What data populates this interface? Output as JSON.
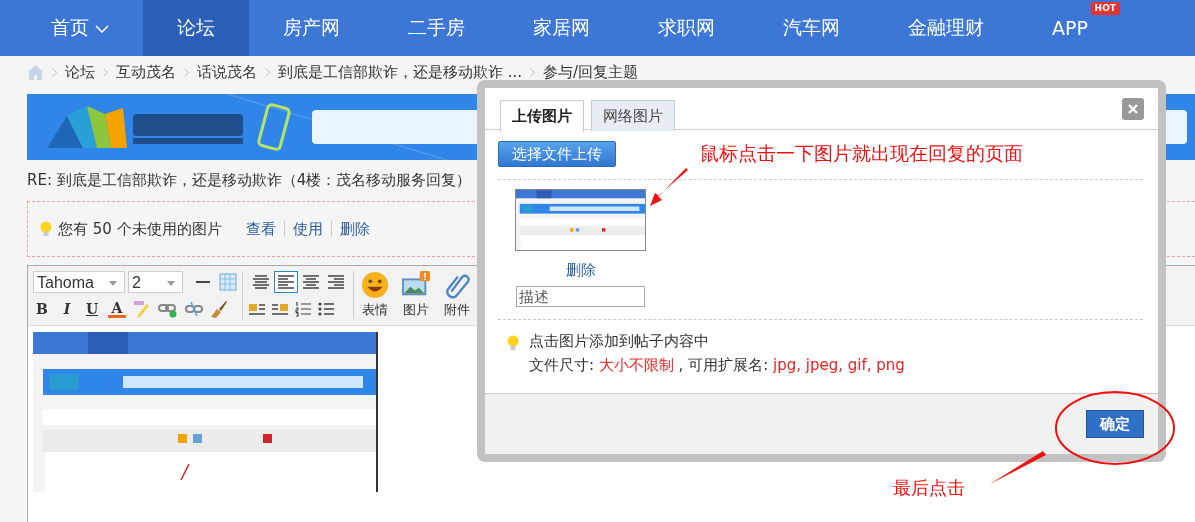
{
  "nav": {
    "items": [
      {
        "label": "首页",
        "selected": false,
        "dropdown": true
      },
      {
        "label": "论坛",
        "selected": true
      },
      {
        "label": "房产网",
        "selected": false
      },
      {
        "label": "二手房",
        "selected": false
      },
      {
        "label": "家居网",
        "selected": false
      },
      {
        "label": "求职网",
        "selected": false
      },
      {
        "label": "汽车网",
        "selected": false
      },
      {
        "label": "金融理财",
        "selected": false
      },
      {
        "label": "APP",
        "selected": false,
        "badge": "HOT"
      }
    ]
  },
  "breadcrumb": [
    "论坛",
    "互动茂名",
    "话说茂名",
    "到底是工信部欺诈，还是移动欺诈 ...",
    "参与/回复主题"
  ],
  "banner": {
    "kind": "picture"
  },
  "post_title": "RE: 到底是工信部欺诈，还是移动欺诈（4楼：茂名移动服务回复）",
  "notice": {
    "text": "您有 50 个未使用的图片",
    "links": [
      "查看",
      "使用",
      "删除"
    ]
  },
  "editor": {
    "font": "Tahoma",
    "size": "2",
    "format_buttons": [
      "B",
      "I",
      "U",
      "A"
    ],
    "align": [
      {
        "selected": false
      },
      {
        "selected": true
      },
      {
        "selected": false
      },
      {
        "selected": false
      }
    ],
    "tools": [
      {
        "label": "表情",
        "kind": "emoji",
        "badge": false
      },
      {
        "label": "图片",
        "badge": true
      },
      {
        "label": "附件",
        "kind": "attach",
        "badge": false
      }
    ],
    "content": {
      "kind": "picture"
    }
  },
  "dialog": {
    "tabs": [
      {
        "label": "上传图片",
        "selected": true
      },
      {
        "label": "网络图片",
        "selected": false
      }
    ],
    "upload_button": "选择文件上传",
    "images": [
      {
        "action": "删除",
        "placeholder": "描述"
      }
    ],
    "tips": {
      "line1": "点击图片添加到帖子内容中",
      "size_label": "文件尺寸: ",
      "size_value": "大小不限制",
      "ext_label": " , 可用扩展名: ",
      "ext_value": "jpg, jpeg, gif, png"
    },
    "confirm": "确定"
  },
  "annotations": [
    {
      "kind": "callout",
      "text": "鼠标点击一下图片就出现在回复的页面"
    },
    {
      "kind": "callout",
      "text": "最后点击"
    }
  ]
}
